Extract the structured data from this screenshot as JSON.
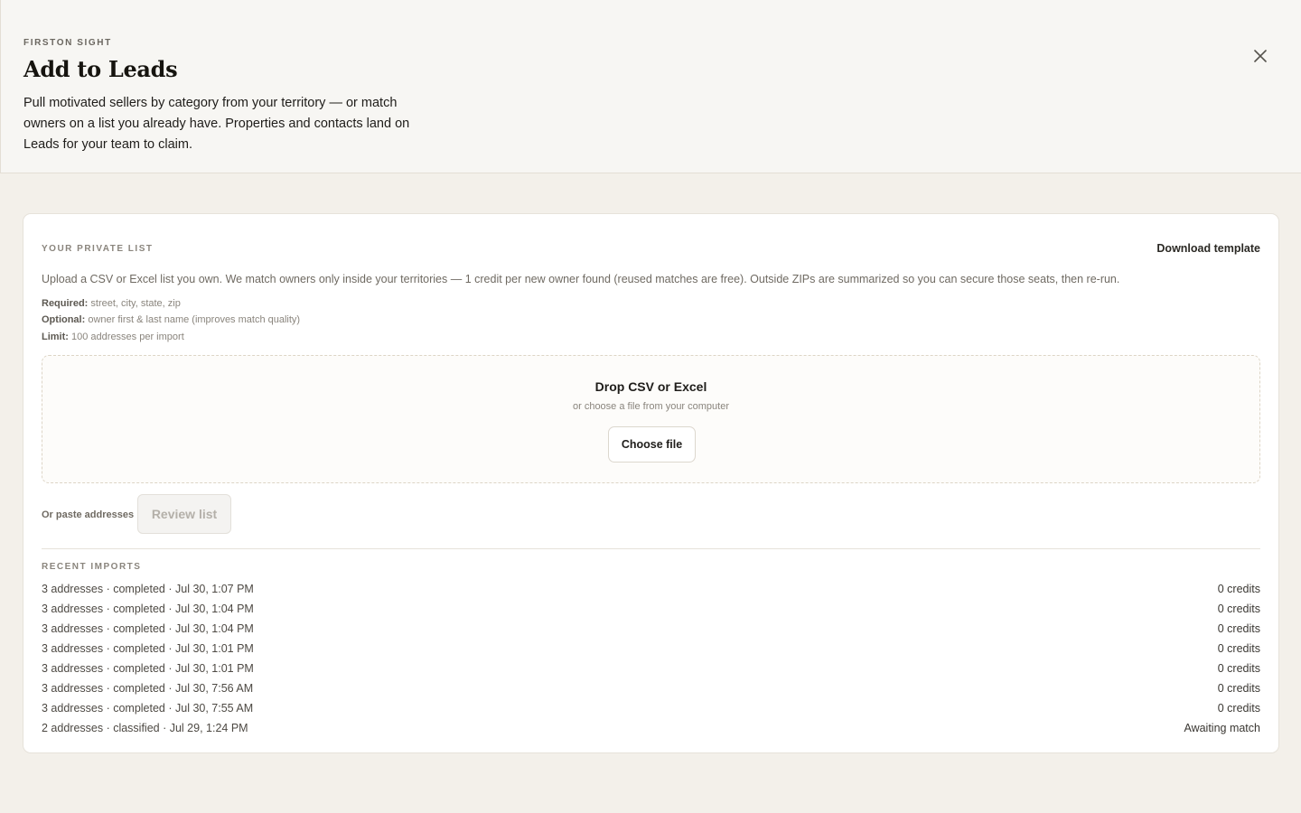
{
  "header": {
    "eyebrow": "FIRSTON SIGHT",
    "title": "Add to Leads",
    "description": "Pull motivated sellers by category from your territory — or match owners on a list you already have. Properties and contacts land on Leads for your team to claim."
  },
  "private_list": {
    "section_label": "YOUR PRIVATE LIST",
    "download_label": "Download template",
    "intro": "Upload a CSV or Excel list you own. We match owners only inside your territories — 1 credit per new owner found (reused matches are free). Outside ZIPs are summarized so you can secure those seats, then re-run.",
    "requirements": [
      {
        "key": "Required:",
        "value": "street, city, state, zip"
      },
      {
        "key": "Optional:",
        "value": "owner first & last name (improves match quality)"
      },
      {
        "key": "Limit:",
        "value": "100 addresses per import"
      }
    ],
    "dropzone": {
      "title": "Drop CSV or Excel",
      "subtitle": "or choose a file from your computer",
      "button": "Choose file"
    },
    "paste_label": "Or paste addresses",
    "review_button": "Review list"
  },
  "recent_imports": {
    "label": "RECENT IMPORTS",
    "rows": [
      {
        "summary": "3 addresses · completed · Jul 30, 1:07 PM",
        "status": "0 credits"
      },
      {
        "summary": "3 addresses · completed · Jul 30, 1:04 PM",
        "status": "0 credits"
      },
      {
        "summary": "3 addresses · completed · Jul 30, 1:04 PM",
        "status": "0 credits"
      },
      {
        "summary": "3 addresses · completed · Jul 30, 1:01 PM",
        "status": "0 credits"
      },
      {
        "summary": "3 addresses · completed · Jul 30, 1:01 PM",
        "status": "0 credits"
      },
      {
        "summary": "3 addresses · completed · Jul 30, 7:56 AM",
        "status": "0 credits"
      },
      {
        "summary": "3 addresses · completed · Jul 30, 7:55 AM",
        "status": "0 credits"
      },
      {
        "summary": "2 addresses · classified · Jul 29, 1:24 PM",
        "status": "Awaiting match"
      }
    ]
  },
  "icons": {
    "close": "close-icon"
  }
}
